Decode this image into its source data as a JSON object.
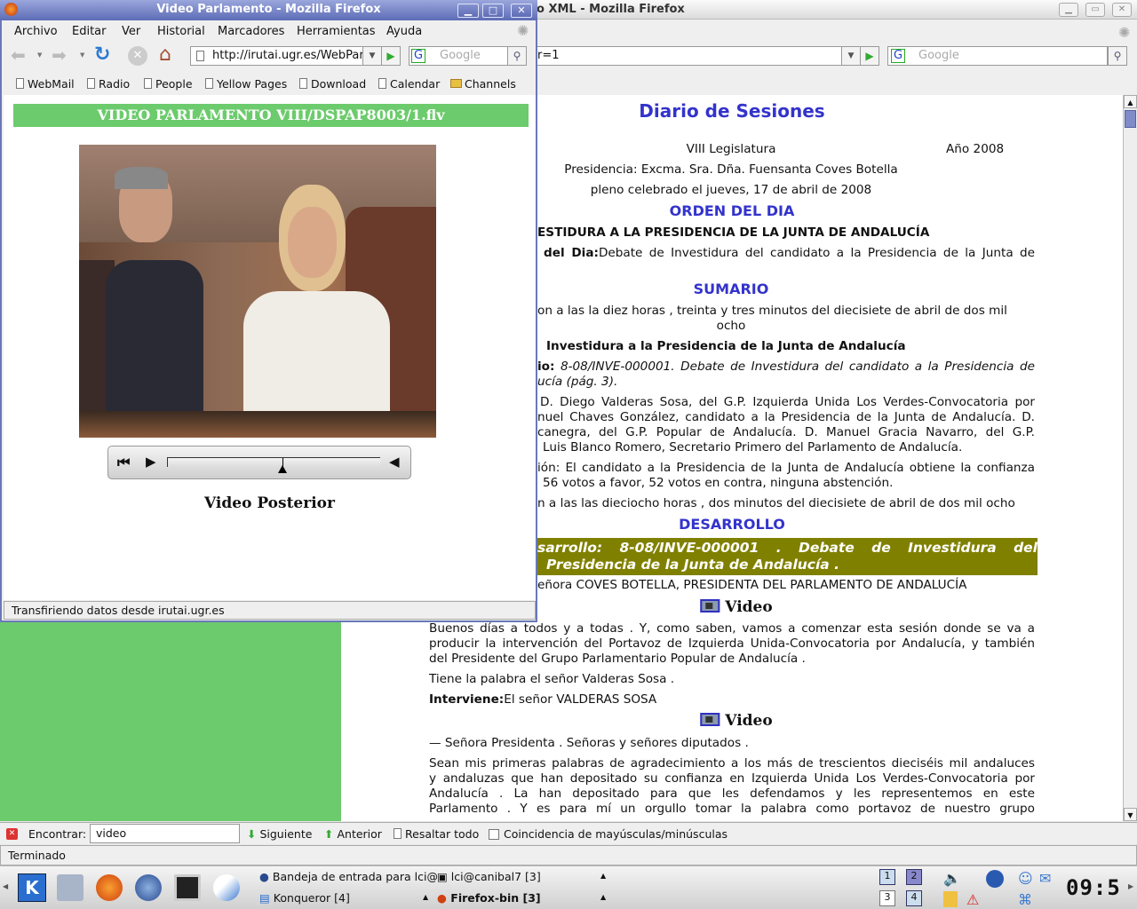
{
  "background_window": {
    "title": "o XML - Mozilla Firefox",
    "url_fragment": "r=1",
    "search_placeholder": "Google",
    "document": {
      "title": "Diario de Sesiones",
      "legislatura": "VIII Legislatura",
      "year": "Año 2008",
      "presidencia": "Presidencia: Excma. Sra. Dña. Fuensanta Coves Botella",
      "pleno": "pleno celebrado el jueves, 17 de abril de 2008",
      "orden_heading": "ORDEN DEL DIA",
      "orden_title": "ESTIDURA A LA PRESIDENCIA DE LA JUNTA DE ANDALUCÍA",
      "orden_label": "del Dia:",
      "orden_text": "Debate de Investidura del candidato a la Presidencia de la Junta de",
      "sumario_heading": "SUMARIO",
      "sumario_open_1": "on a las la diez horas , treinta y tres minutos del diecisiete de abril de dos mil",
      "sumario_open_2": "ocho",
      "sumario_subtitle": "Investidura a la Presidencia de la Junta de Andalucía",
      "sumario_label": "io:",
      "sumario_item_1": "8-08/INVE-000001. Debate de Investidura del candidato a la Presidencia de",
      "sumario_item_2": "ucía (pág. 3).",
      "speakers": [
        "D. Diego Valderas Sosa, del G.P. Izquierda Unida Los Verdes-Convocatoria por",
        "nuel Chaves González, candidato a la Presidencia de la Junta de Andalucía. D.",
        "canegra, del G.P. Popular de Andalucía. D. Manuel Gracia Navarro, del G.P.",
        "Luis Blanco Romero, Secretario Primero del Parlamento de Andalucía."
      ],
      "votacion": [
        "ión: El candidato a la Presidencia de la Junta de Andalucía obtiene la confianza",
        "56 votos a favor, 52 votos en contra, ninguna abstención."
      ],
      "cierre": "n a las las dieciocho horas , dos minutos del diecisiete de abril de dos mil ocho",
      "desarrollo_heading": "DESARROLLO",
      "desarrollo_box": [
        "sarrollo:  8-08/INVE-000001  .  Debate  de  Investidura  del",
        "Presidencia de la Junta de Andalucía ."
      ],
      "presidenta": "eñora COVES BOTELLA, PRESIDENTA DEL PARLAMENTO DE ANDALUCÍA",
      "video_link": "Video",
      "intro": [
        "Buenos días a todos y a todas . Y, como saben, vamos a comenzar esta sesión donde se va a",
        "producir la intervención del Portavoz de Izquierda Unida-Convocatoria por Andalucía, y también",
        "del Presidente del Grupo Parlamentario Popular de Andalucía ."
      ],
      "palabra": "Tiene la palabra el señor Valderas Sosa .",
      "interviene_label": "Interviene:",
      "interviene_text": "El señor VALDERAS SOSA",
      "saludo": "— Señora Presidenta . Señoras y señores diputados .",
      "discurso": [
        "Sean mis primeras palabras de agradecimiento a los más de trescientos dieciséis mil andaluces",
        "y andaluzas que han depositado su confianza en Izquierda Unida Los Verdes-Convocatoria por",
        "Andalucía . La han depositado para que les defendamos y les representemos en este",
        "Parlamento . Y es para mí un orgullo tomar la palabra como portavoz de nuestro grupo"
      ]
    },
    "find_bar": {
      "label": "Encontrar:",
      "value": "video",
      "next": "Siguiente",
      "prev": "Anterior",
      "highlight": "Resaltar todo",
      "match_case": "Coincidencia de mayúsculas/minúsculas"
    },
    "status": "Terminado"
  },
  "front_window": {
    "title": "Video Parlamento - Mozilla Firefox",
    "menu": [
      "Archivo",
      "Editar",
      "Ver",
      "Historial",
      "Marcadores",
      "Herramientas",
      "Ayuda"
    ],
    "url": "http://irutai.ugr.es/WebParl",
    "search_placeholder": "Google",
    "bookmarks": [
      "WebMail",
      "Radio",
      "People",
      "Yellow Pages",
      "Download",
      "Calendar",
      "Channels"
    ],
    "video_title": "VIDEO PARLAMENTO VIII/DSPAP8003/1.flv",
    "playback_progress": 0.54,
    "next_video": "Video Posterior",
    "status": "Transfiriendo datos desde irutai.ugr.es"
  },
  "taskbar": {
    "tasks": [
      "Bandeja de entrada para lci@",
      "lci@canibal7 [3]",
      "Konqueror [4]",
      "Firefox-bin [3]"
    ],
    "desktops": [
      "1",
      "2",
      "3",
      "4"
    ],
    "clock": "09:5"
  },
  "colors": {
    "heading_blue": "#3333cc",
    "green": "#6ccb6c",
    "olive": "#808000",
    "title_blue": "#5d6cb6"
  }
}
